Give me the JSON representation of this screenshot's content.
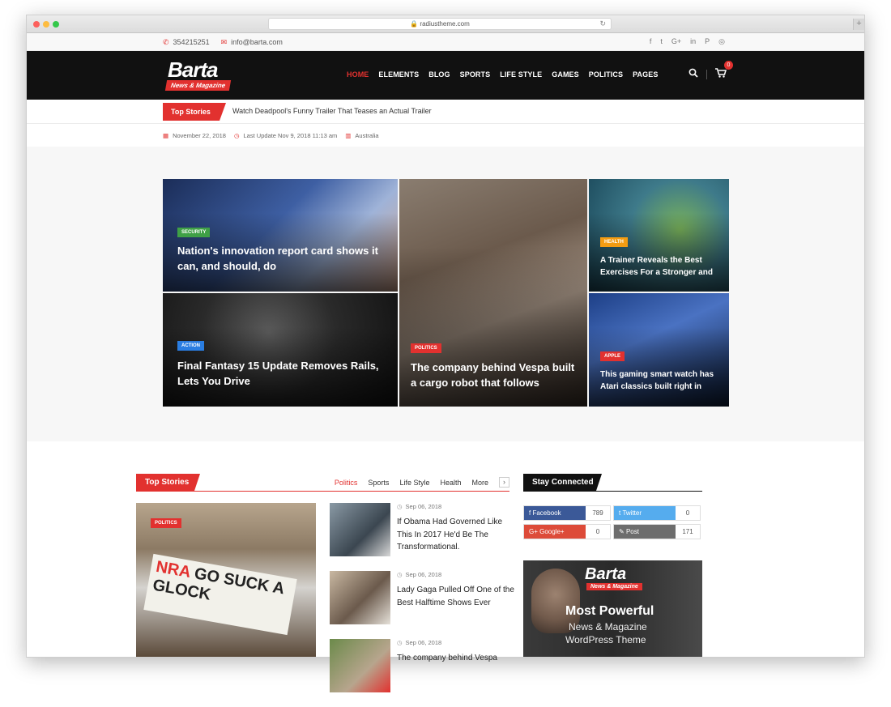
{
  "browser": {
    "url": "radiustheme.com"
  },
  "topbar": {
    "phone": "354215251",
    "email": "info@barta.com"
  },
  "social_icons": [
    "facebook-icon",
    "twitter-icon",
    "google-plus-icon",
    "linkedin-icon",
    "pinterest-icon",
    "instagram-icon"
  ],
  "logo": {
    "word": "Barta",
    "tagline": "News & Magazine"
  },
  "nav": {
    "items": [
      "HOME",
      "ELEMENTS",
      "BLOG",
      "SPORTS",
      "LIFE STYLE",
      "GAMES",
      "POLITICS",
      "PAGES"
    ],
    "cart_count": "0"
  },
  "ticker": {
    "label": "Top Stories",
    "text": "Watch Deadpool's Funny Trailer That Teases an Actual Trailer"
  },
  "datebar": {
    "date": "November 22, 2018",
    "updated": "Last Update Nov 9, 2018 11:13 am",
    "location": "Australia"
  },
  "hero": {
    "tiles": [
      {
        "category": "SECURITY",
        "title": "Nation's innovation report card shows it can, and should, do",
        "cat_color": "#3fa046"
      },
      {
        "category": "ACTION",
        "title": "Final Fantasy 15 Update Removes Rails, Lets You Drive",
        "cat_color": "#2a7de1"
      },
      {
        "category": "POLITICS",
        "title": "The company behind Vespa built a cargo robot that follows",
        "cat_color": "#e2312f"
      },
      {
        "category": "HEALTH",
        "title": "A Trainer Reveals the Best Exercises For a Stronger and",
        "cat_color": "#f39c12"
      },
      {
        "category": "APPLE",
        "title": "This gaming smart watch has Atari classics built right in",
        "cat_color": "#e2312f"
      }
    ]
  },
  "top_stories": {
    "label": "Top Stories",
    "tabs": [
      "Politics",
      "Sports",
      "Life Style",
      "Health",
      "More"
    ],
    "featured": {
      "category": "POLITICS",
      "sign_text": "NRA GO SUCK A GLOCK"
    },
    "items": [
      {
        "date": "Sep 06, 2018",
        "title": "If Obama Had Governed Like This In 2017 He'd Be The Transformational."
      },
      {
        "date": "Sep 06, 2018",
        "title": "Lady Gaga Pulled Off One of the Best Halftime Shows Ever"
      },
      {
        "date": "Sep 06, 2018",
        "title": "The company behind Vespa"
      }
    ]
  },
  "stay_connected": {
    "label": "Stay Connected",
    "buttons": [
      {
        "name": "Facebook",
        "count": "789",
        "color": "#3b5998"
      },
      {
        "name": "Twitter",
        "count": "0",
        "color": "#55acee"
      },
      {
        "name": "Google+",
        "count": "0",
        "color": "#dd4b39"
      },
      {
        "name": "Post",
        "count": "171",
        "color": "#6d6d6d"
      }
    ]
  },
  "ad": {
    "logo_word": "Barta",
    "logo_tag": "News & Magazine",
    "headline": "Most Powerful",
    "line1": "News & Magazine",
    "line2": "WordPress Theme"
  }
}
